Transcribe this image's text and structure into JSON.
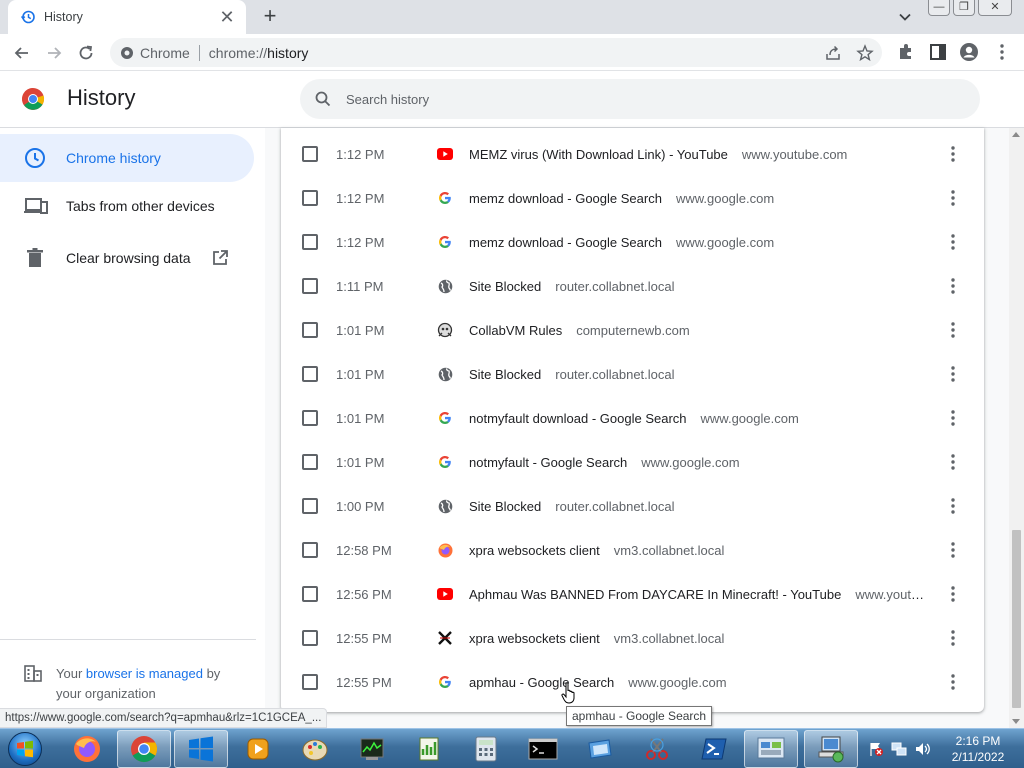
{
  "tab": {
    "title": "History",
    "close": "✕",
    "newtab": "+"
  },
  "window": {
    "minimize": "—",
    "maximize": "❐",
    "close": "✕"
  },
  "omnibox": {
    "label": "Chrome",
    "scheme": "chrome://",
    "path": "history"
  },
  "header": {
    "title": "History",
    "search_placeholder": "Search history"
  },
  "sidebar": {
    "items": [
      {
        "label": "Chrome history"
      },
      {
        "label": "Tabs from other devices"
      },
      {
        "label": "Clear browsing data"
      }
    ],
    "managed_prefix": "Your ",
    "managed_link": "browser is managed",
    "managed_suffix": " by your organization"
  },
  "history": [
    {
      "time": "1:12 PM",
      "title": "MEMZ virus (With Download Link) - YouTube",
      "domain": "www.youtube.com",
      "icon": "youtube-icon"
    },
    {
      "time": "1:12 PM",
      "title": "memz download - Google Search",
      "domain": "www.google.com",
      "icon": "google-icon"
    },
    {
      "time": "1:12 PM",
      "title": "memz download - Google Search",
      "domain": "www.google.com",
      "icon": "google-icon"
    },
    {
      "time": "1:11 PM",
      "title": "Site Blocked",
      "domain": "router.collabnet.local",
      "icon": "globe-icon"
    },
    {
      "time": "1:01 PM",
      "title": "CollabVM Rules",
      "domain": "computernewb.com",
      "icon": "collabvm-icon"
    },
    {
      "time": "1:01 PM",
      "title": "Site Blocked",
      "domain": "router.collabnet.local",
      "icon": "globe-icon"
    },
    {
      "time": "1:01 PM",
      "title": "notmyfault download - Google Search",
      "domain": "www.google.com",
      "icon": "google-icon"
    },
    {
      "time": "1:01 PM",
      "title": "notmyfault - Google Search",
      "domain": "www.google.com",
      "icon": "google-icon"
    },
    {
      "time": "1:00 PM",
      "title": "Site Blocked",
      "domain": "router.collabnet.local",
      "icon": "globe-icon"
    },
    {
      "time": "12:58 PM",
      "title": "xpra websockets client",
      "domain": "vm3.collabnet.local",
      "icon": "firefox-icon"
    },
    {
      "time": "12:56 PM",
      "title": "Aphmau Was BANNED From DAYCARE In Minecraft! - YouTube",
      "domain": "www.youtube.com",
      "icon": "youtube-icon"
    },
    {
      "time": "12:55 PM",
      "title": "xpra websockets client",
      "domain": "vm3.collabnet.local",
      "icon": "xpra-icon"
    },
    {
      "time": "12:55 PM",
      "title": "apmhau - Google Search",
      "domain": "www.google.com",
      "icon": "google-icon"
    }
  ],
  "statusbar": "https://www.google.com/search?q=apmhau&rlz=1C1GCEA_...",
  "tooltip": "apmhau - Google Search",
  "clock": {
    "time": "2:16 PM",
    "date": "2/11/2022"
  },
  "colors": {
    "accent": "#1a73e8",
    "youtube": "#ff0000",
    "taskbar": "#3e6f9c"
  }
}
